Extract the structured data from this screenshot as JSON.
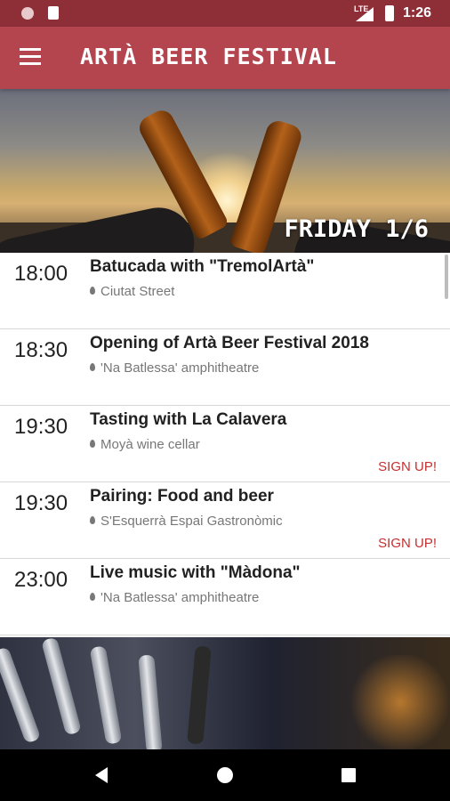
{
  "status_bar": {
    "network": "LTE",
    "time": "1:26"
  },
  "app_bar": {
    "title": "Artà Beer Festival"
  },
  "hero": {
    "day_label": "Friday 1/6"
  },
  "events": [
    {
      "time": "18:00",
      "title": "Batucada with \"TremolArtà\"",
      "location": "Ciutat Street",
      "signup": ""
    },
    {
      "time": "18:30",
      "title": "Opening of Artà Beer Festival 2018",
      "location": "'Na Batlessa' amphitheatre",
      "signup": ""
    },
    {
      "time": "19:30",
      "title": "Tasting with La Calavera",
      "location": "Moyà wine cellar",
      "signup": "SIGN UP!"
    },
    {
      "time": "19:30",
      "title": "Pairing: Food and beer",
      "location": "S'Esquerrà Espai Gastronòmic",
      "signup": "SIGN UP!"
    },
    {
      "time": "23:00",
      "title": "Live music with \"Màdona\"",
      "location": "'Na Batlessa' amphitheatre",
      "signup": ""
    }
  ],
  "colors": {
    "status_bar": "#8e2f38",
    "app_bar": "#b4454f",
    "signup": "#c52f2f"
  },
  "icons": {
    "menu": "menu-icon",
    "location": "location-pin-icon",
    "nav_back": "back-icon",
    "nav_home": "home-icon",
    "nav_recent": "recent-apps-icon"
  }
}
